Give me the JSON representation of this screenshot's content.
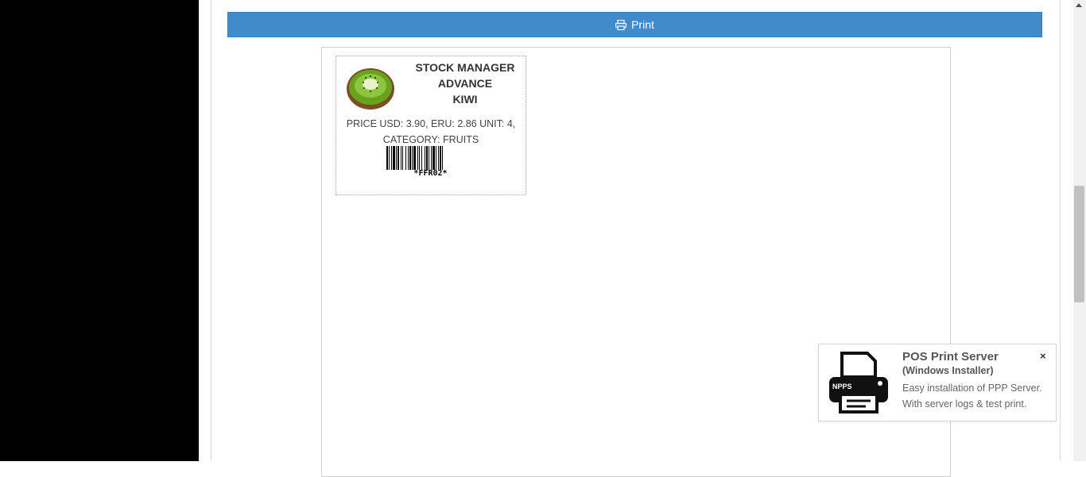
{
  "toolbar": {
    "print_label": "Print",
    "print_icon": "print-icon",
    "button_color": "#428bca"
  },
  "label": {
    "site_name_line1": "STOCK MANAGER",
    "site_name_line2": "ADVANCE",
    "product_name": "KIWI",
    "price_line1": "PRICE USD: 3.90, ERU: 2.86 UNIT: 4,",
    "price_line2": "CATEGORY: FRUITS",
    "barcode_text": "*FFR02*",
    "image_icon": "kiwi-image"
  },
  "popup": {
    "title": "POS Print Server",
    "subtitle": "(Windows Installer)",
    "desc_line1": "Easy installation of PPP Server.",
    "desc_line2": "With server logs & test print.",
    "printer_logo_text": "NPPS",
    "close_label": "×"
  }
}
